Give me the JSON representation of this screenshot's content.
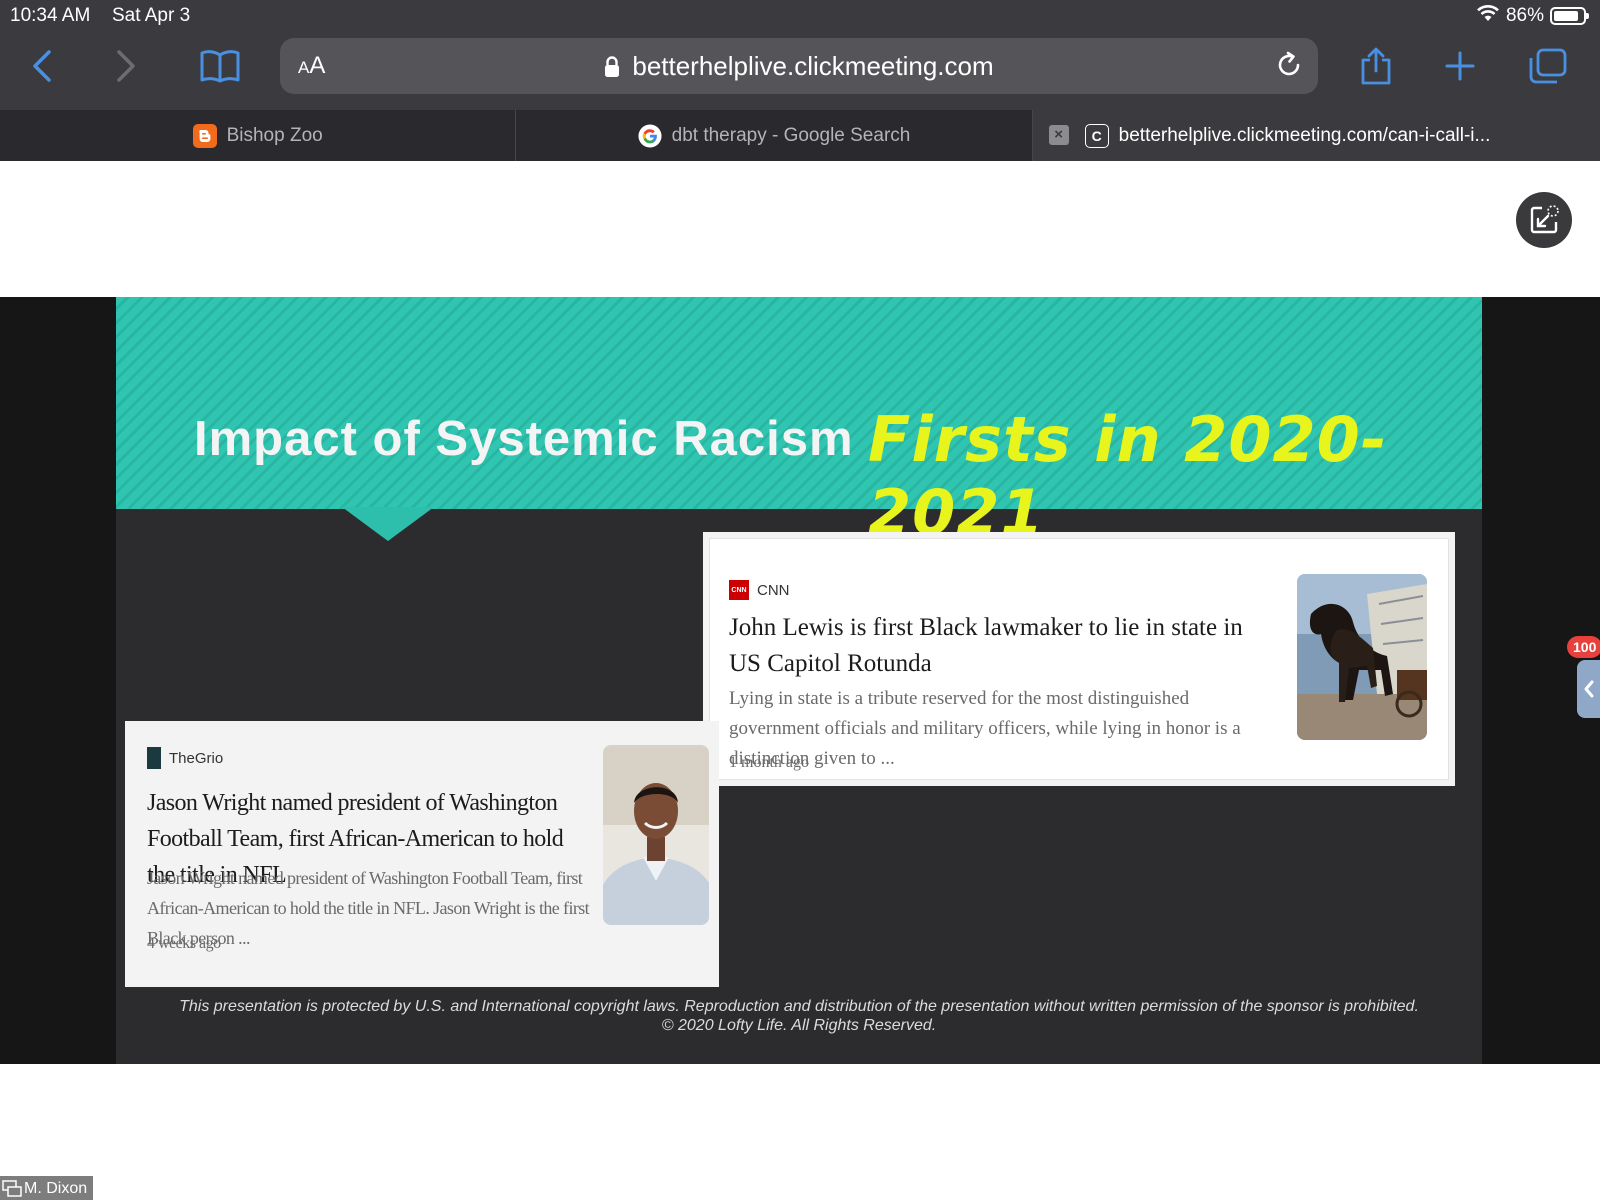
{
  "status_bar": {
    "time": "10:34 AM",
    "date": "Sat Apr 3",
    "battery_text": "86%",
    "battery_level": 0.86
  },
  "toolbar": {
    "text_size_label_small": "A",
    "text_size_label_large": "A",
    "url": "betterhelplive.clickmeeting.com"
  },
  "tabs": [
    {
      "label": "Bishop Zoo",
      "icon": "blogger-icon",
      "color": "#f26b1d"
    },
    {
      "label": "dbt therapy - Google Search",
      "icon": "google-icon"
    },
    {
      "label": "betterhelplive.clickmeeting.com/can-i-call-i...",
      "icon": "clickmeeting-icon",
      "active": true
    }
  ],
  "slide": {
    "title": "Impact of Systemic Racism",
    "accent_title": "Firsts in 2020-2021",
    "accent_color": "#e7f51c",
    "banner_color": "#2ebfac",
    "cards": {
      "cnn": {
        "source": "CNN",
        "source_logo_text": "CNN",
        "headline": "John Lewis is first Black lawmaker to lie in state in US Capitol Rotunda",
        "snippet": "Lying in state is a tribute reserved for the most distinguished government officials and military officers, while lying in honor is a distinction given to ...",
        "age": "1 month ago"
      },
      "thegrio": {
        "source": "TheGrio",
        "headline": "Jason Wright named president of Washington Football Team, first African-American to hold the title in NFL",
        "snippet": "Jason Wright named president of Washington Football Team, first African-American to hold the title in NFL. Jason Wright is the first Black person ...",
        "age": "4 weeks ago"
      }
    },
    "footer_line1": "This presentation is protected by U.S. and International copyright laws. Reproduction and distribution of the presentation without written permission of the sponsor is prohibited.",
    "footer_line2": "© 2020 Lofty Life. All Rights Reserved."
  },
  "side_badge": "100",
  "presenter": "M. Dixon"
}
